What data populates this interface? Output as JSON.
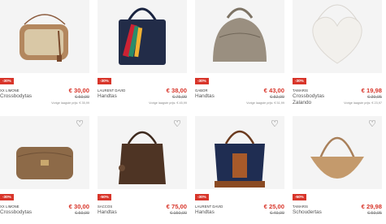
{
  "products": [
    {
      "brand": "XX LIMONE",
      "name": "Crossbodytas",
      "discount": "-30%",
      "price": "€ 30,00",
      "old_price": "€ 59,99",
      "lowest": "Vorige laagste prijs: € 35,99"
    },
    {
      "brand": "LAURENT DAVID",
      "name": "Handtas",
      "discount": "-30%",
      "price": "€ 38,00",
      "old_price": "€ 75,99",
      "lowest": "Vorige laagste prijs: € 45,99"
    },
    {
      "brand": "GABOR",
      "name": "Handtas",
      "discount": "-30%",
      "price": "€ 43,00",
      "old_price": "€ 82,99",
      "lowest": "Vorige laagste prijs: € 51,99"
    },
    {
      "brand": "TAMARIS",
      "name": "Crossbodytas",
      "sub_name": "Zalando",
      "discount": "-30%",
      "price": "€ 19,98",
      "old_price": "€ 39,95",
      "lowest": "Vorige laagste prijs: € 23,97"
    },
    {
      "brand": "XX LIMONE",
      "name": "Crossbodytas",
      "discount": "-30%",
      "price": "€ 30,00",
      "old_price": "€ 59,99"
    },
    {
      "brand": "SACCOS",
      "name": "Handtas",
      "discount": "-50%",
      "price": "€ 75,00",
      "old_price": "€ 150,00"
    },
    {
      "brand": "LAURENT DAVID",
      "name": "Handtas",
      "discount": "-30%",
      "price": "€ 25,00",
      "old_price": "€ 49,99"
    },
    {
      "brand": "TAMARIS",
      "name": "Schoudertas",
      "discount": "-50%",
      "price": "€ 29,98",
      "old_price": "€ 59,95"
    }
  ],
  "colors": {
    "accent": "#d8352a",
    "image_bg": "#f4f4f4"
  },
  "icons": {
    "wishlist": "heart-outline-icon"
  }
}
